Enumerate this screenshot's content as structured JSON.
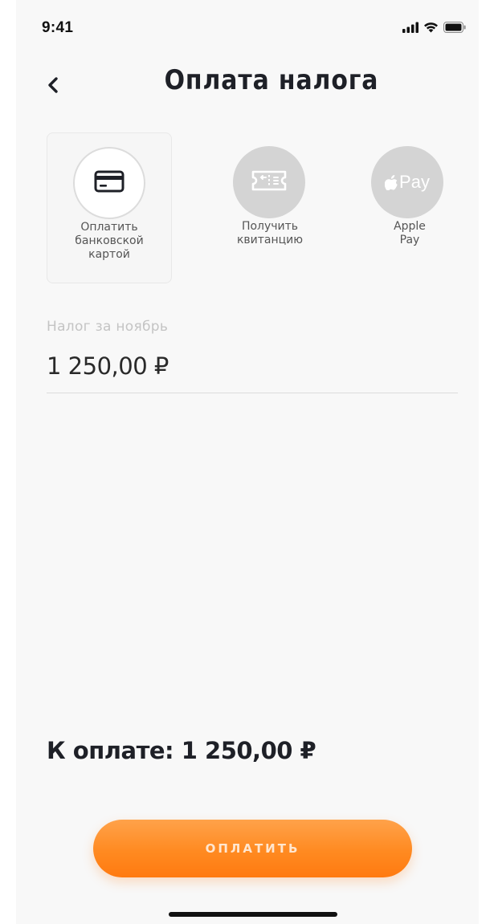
{
  "status_bar": {
    "time": "9:41",
    "icons": [
      "cellular-signal-icon",
      "wifi-icon",
      "battery-icon"
    ]
  },
  "header": {
    "back_icon": "chevron-left-icon",
    "title": "Оплата налога"
  },
  "payment_options": [
    {
      "label": "Оплатить\nбанковской\nкартой",
      "icon": "credit-card-icon",
      "selected": true
    },
    {
      "label": "Получить\nквитанцию",
      "icon": "ticket-icon",
      "selected": false
    },
    {
      "label": "Apple\nPay",
      "icon": "apple-pay-icon",
      "icon_text": "Pay",
      "selected": false
    }
  ],
  "amount_field": {
    "label": "Налог за ноябрь",
    "value": "1 250,00 ₽"
  },
  "total": {
    "text": "К оплате: 1 250,00 ₽"
  },
  "pay_button": {
    "label": "ОПЛАТИТЬ"
  },
  "colors": {
    "accent": "#ff8a21",
    "background": "#f8f8f8",
    "title": "#1e2027",
    "muted": "#c4c4c4",
    "inactive_icon_bg": "#d4d4d4"
  }
}
